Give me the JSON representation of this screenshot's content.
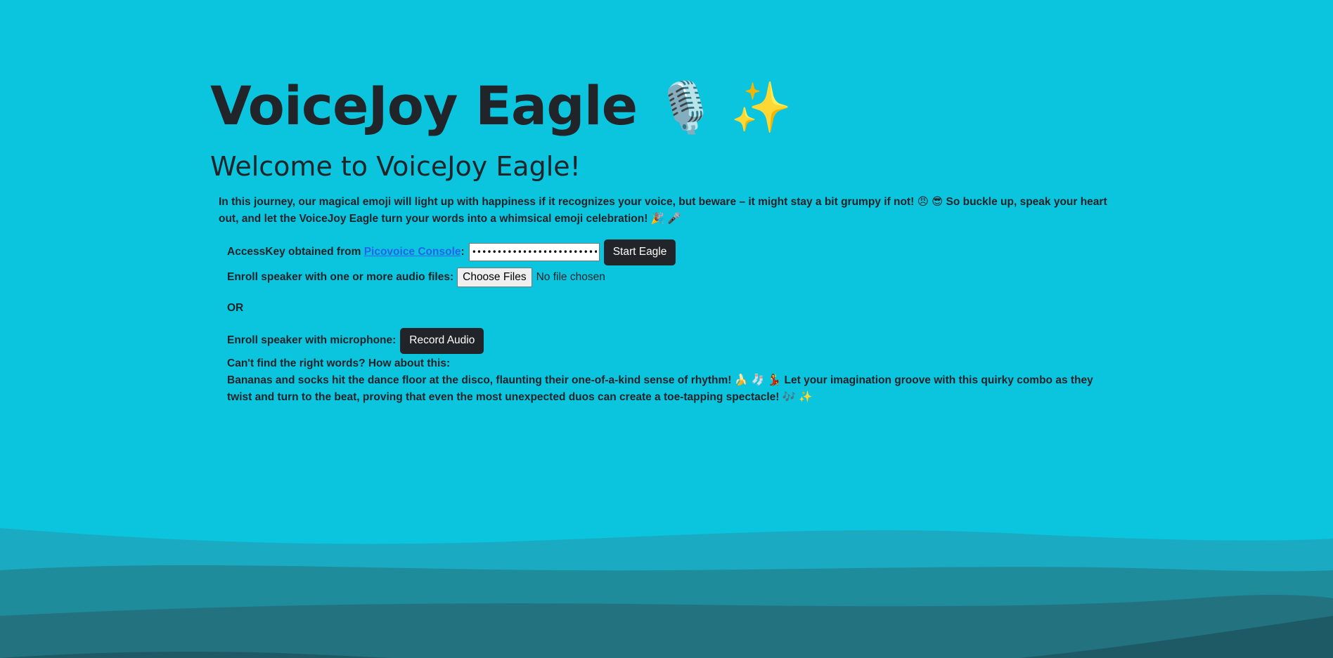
{
  "header": {
    "title": "VoiceJoy Eagle",
    "title_emojis": "🎙️ ✨",
    "welcome": "Welcome to VoiceJoy Eagle!"
  },
  "intro": {
    "text": "In this journey, our magical emoji will light up with happiness if it recognizes your voice, but beware – it might stay a bit grumpy if not! 😠 😎 So buckle up, speak your heart out, and let the VoiceJoy Eagle turn your words into a whimsical emoji celebration! 🎉 🎤"
  },
  "access_key": {
    "label_prefix": "AccessKey obtained from ",
    "link_text": "Picovoice Console",
    "label_suffix": ":",
    "value": "••••••••••••••••••••••••••••",
    "start_button": "Start Eagle"
  },
  "enroll_files": {
    "label": "Enroll speaker with one or more audio files:",
    "choose_button": "Choose Files",
    "status": "No file chosen"
  },
  "or_text": "OR",
  "enroll_mic": {
    "label": "Enroll speaker with microphone:",
    "record_button": "Record Audio"
  },
  "suggestion": {
    "title": "Can't find the right words? How about this:",
    "text": "Bananas and socks hit the dance floor at the disco, flaunting their one-of-a-kind sense of rhythm! 🍌 🧦 💃 Let your imagination groove with this quirky combo as they twist and turn to the beat, proving that even the most unexpected duos can create a toe-tapping spectacle! 🎶 ✨"
  },
  "colors": {
    "background": "#0bc5df",
    "button_dark": "#212529",
    "link": "#2563eb",
    "wave_1": "#1aabc2",
    "wave_2": "#1f8c9c",
    "wave_3": "#237280",
    "wave_4": "#1e5a65"
  }
}
